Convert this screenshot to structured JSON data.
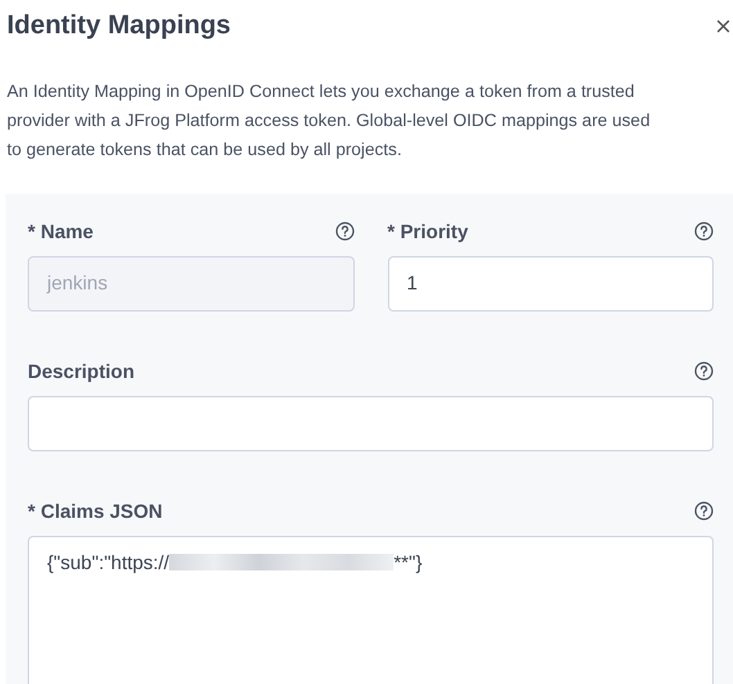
{
  "dialog": {
    "title": "Identity Mappings",
    "intro_lines": [
      "An Identity Mapping in OpenID Connect lets you exchange a token from a trusted",
      "provider with a JFrog Platform access token. Global-level OIDC mappings are used",
      "to generate tokens that can be used by all projects."
    ]
  },
  "form_rows": [
    [
      {
        "label": "* Name",
        "kind": "input",
        "disabled": true,
        "value": "jenkins"
      },
      {
        "label": "* Priority",
        "kind": "input",
        "disabled": false,
        "value": "1"
      }
    ],
    [
      {
        "label": "Description",
        "kind": "input",
        "disabled": false
      }
    ],
    [
      {
        "label": "* Claims JSON",
        "kind": "textarea",
        "disabled": false,
        "value": "{\"sub\":\"https://",
        "redacted": true,
        "value_end": "**\"}"
      }
    ]
  ]
}
